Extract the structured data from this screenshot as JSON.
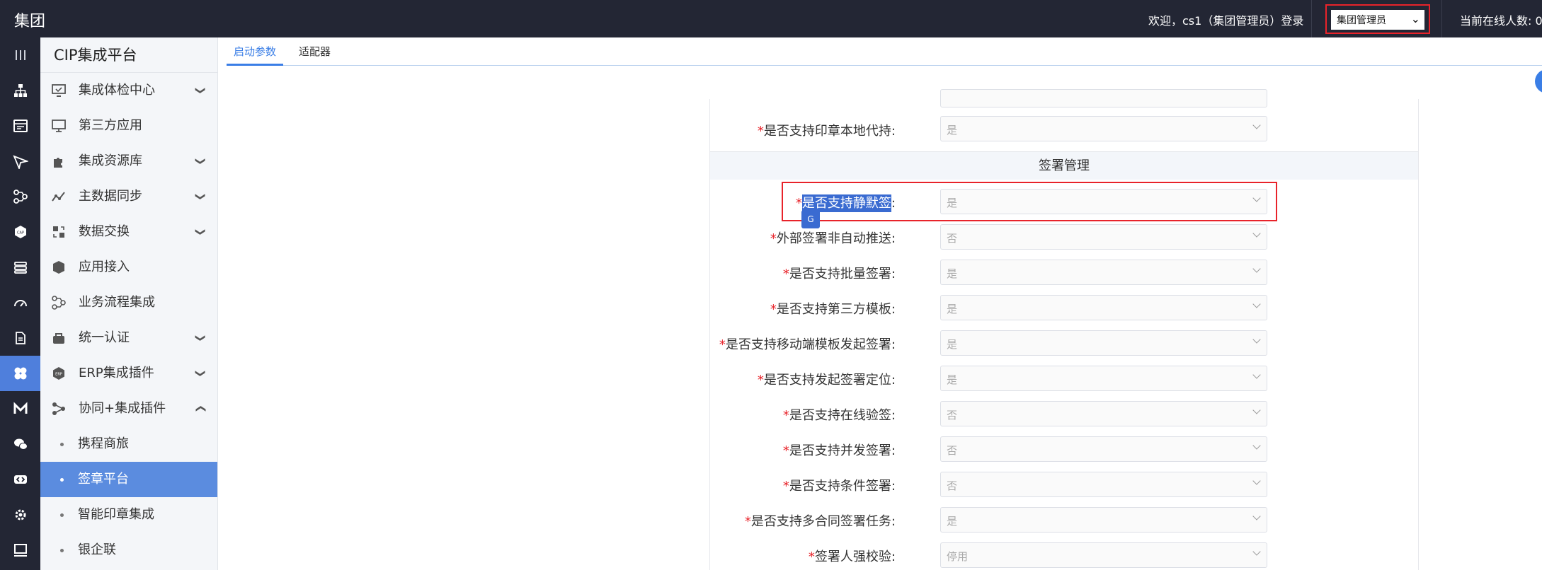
{
  "header": {
    "brand": "集团",
    "welcome": "欢迎，cs1（集团管理员）登录",
    "role_select": "集团管理员",
    "online": "当前在线人数: 0"
  },
  "sidebar": {
    "title": "CIP集成平台",
    "items": [
      {
        "label": "集成体检中心",
        "icon": "monitor-check-icon",
        "expand": "down"
      },
      {
        "label": "第三方应用",
        "icon": "desktop-icon",
        "expand": ""
      },
      {
        "label": "集成资源库",
        "icon": "puzzle-icon",
        "expand": "down"
      },
      {
        "label": "主数据同步",
        "icon": "line-chart-icon",
        "expand": "down"
      },
      {
        "label": "数据交换",
        "icon": "exchange-icon",
        "expand": "down"
      },
      {
        "label": "应用接入",
        "icon": "cube-icon",
        "expand": ""
      },
      {
        "label": "业务流程集成",
        "icon": "flow-icon",
        "expand": ""
      },
      {
        "label": "统一认证",
        "icon": "auth-icon",
        "expand": "down"
      },
      {
        "label": "ERP集成插件",
        "icon": "erp-icon",
        "expand": "down"
      },
      {
        "label": "协同+集成插件",
        "icon": "share-icon",
        "expand": "up"
      }
    ],
    "subitems": [
      {
        "label": "携程商旅"
      },
      {
        "label": "签章平台"
      },
      {
        "label": "智能印章集成"
      },
      {
        "label": "银企联"
      }
    ]
  },
  "tabs": [
    {
      "label": "启动参数"
    },
    {
      "label": "适配器"
    }
  ],
  "form": {
    "top_row": {
      "label": "是否支持印章本地代持:",
      "value": "是"
    },
    "section_title": "签署管理",
    "rows": [
      {
        "label": "是否支持静默签",
        "suffix": ":",
        "value": "是"
      },
      {
        "label": "外部签署非自动推送:",
        "value": "否"
      },
      {
        "label": "是否支持批量签署:",
        "value": "是"
      },
      {
        "label": "是否支持第三方模板:",
        "value": "是"
      },
      {
        "label": "是否支持移动端模板发起签署:",
        "value": "是"
      },
      {
        "label": "是否支持发起签署定位:",
        "value": "是"
      },
      {
        "label": "是否支持在线验签:",
        "value": "否"
      },
      {
        "label": "是否支持并发签署:",
        "value": "否"
      },
      {
        "label": "是否支持条件签署:",
        "value": "否"
      },
      {
        "label": "是否支持多合同签署任务:",
        "value": "是"
      },
      {
        "label": "签署人强校验:",
        "value": "停用"
      }
    ]
  },
  "colors": {
    "topbar": "#232634",
    "accent": "#4f7fdc",
    "highlight": "#e8232a"
  }
}
